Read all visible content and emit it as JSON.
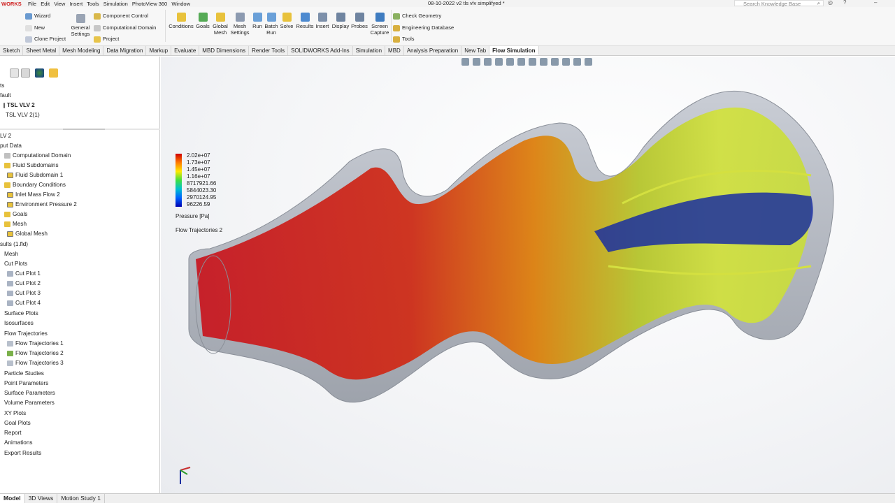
{
  "title_bar": {
    "logo": "WORKS",
    "menu": [
      "File",
      "Edit",
      "View",
      "Insert",
      "Tools",
      "Simulation",
      "PhotoView 360",
      "Window"
    ],
    "document_title": "08-10-2022 v2 tls vlv simplifyed *",
    "search_placeholder": "Search Knowledge Base"
  },
  "ribbon": {
    "wizard": "Wizard",
    "new": "New",
    "clone_project": "Clone Project",
    "general_settings": [
      "General",
      "Settings"
    ],
    "component_control": "Component Control",
    "computational_domain": "Computational Domain",
    "project": "Project",
    "conditions": "Conditions",
    "goals": "Goals",
    "global_mesh": [
      "Global",
      "Mesh"
    ],
    "mesh_settings": [
      "Mesh",
      "Settings"
    ],
    "run": "Run",
    "batch_run": [
      "Batch",
      "Run"
    ],
    "solve": "Solve",
    "results": "Results",
    "insert": "Insert",
    "display": "Display",
    "probes": "Probes",
    "screen_capture": [
      "Screen",
      "Capture"
    ],
    "check_geometry": "Check Geometry",
    "engineering_database": "Engineering Database",
    "tools": "Tools"
  },
  "tabs": [
    "Sketch",
    "Sheet Metal",
    "Mesh Modeling",
    "Data Migration",
    "Markup",
    "Evaluate",
    "MBD Dimensions",
    "Render Tools",
    "SOLIDWORKS Add-Ins",
    "Simulation",
    "MBD",
    "Analysis Preparation",
    "New Tab",
    "Flow Simulation"
  ],
  "active_tab": "Flow Simulation",
  "tree_top": {
    "item_ts": "ts",
    "default": "fault",
    "config_bold": "TSL VLV 2",
    "config": "TSL VLV 2(1)"
  },
  "tree": [
    "LV 2",
    "put Data",
    "Computational Domain",
    "Fluid Subdomains",
    "Fluid Subdomain 1",
    "Boundary Conditions",
    "Inlet Mass Flow 2",
    "Environment Pressure 2",
    "Goals",
    "Mesh",
    "Global Mesh",
    "sults (1.fld)",
    "Mesh",
    "Cut Plots",
    "Cut Plot 1",
    "Cut Plot 2",
    "Cut Plot 3",
    "Cut Plot 4",
    "Surface Plots",
    "Isosurfaces",
    "Flow Trajectories",
    "Flow Trajectories 1",
    "Flow Trajectories 2",
    "Flow Trajectories 3",
    "Particle Studies",
    "Point Parameters",
    "Surface Parameters",
    "Volume Parameters",
    "XY Plots",
    "Goal Plots",
    "Report",
    "Animations",
    "Export Results"
  ],
  "legend": {
    "values": [
      "2.02e+07",
      "1.73e+07",
      "1.45e+07",
      "1.16e+07",
      "8717921.66",
      "5844023.30",
      "2970124.95",
      "96226.59"
    ],
    "quantity": "Pressure [Pa]",
    "trajectory_label": "Flow Trajectories 2",
    "colors": [
      "#d00000",
      "#ff7a00",
      "#ffe800",
      "#40e040",
      "#00c0d0",
      "#0060ff",
      "#0000b0"
    ]
  },
  "bottom_tabs": [
    "Model",
    "3D Views",
    "Motion Study 1"
  ],
  "active_bottom_tab": "Model"
}
